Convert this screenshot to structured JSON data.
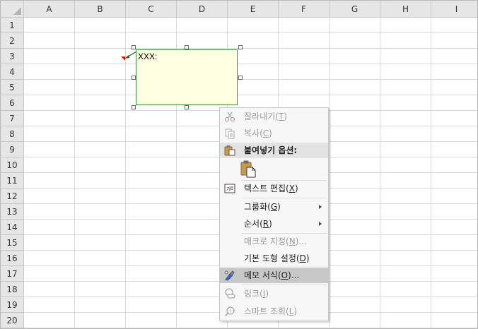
{
  "columns": [
    "A",
    "B",
    "C",
    "D",
    "E",
    "F",
    "G",
    "H",
    "I"
  ],
  "rows": [
    "1",
    "2",
    "3",
    "4",
    "5",
    "6",
    "7",
    "8",
    "9",
    "10",
    "11",
    "12",
    "13",
    "14",
    "15",
    "16",
    "17",
    "18",
    "19",
    "20"
  ],
  "comment": {
    "text": "XXX:"
  },
  "context_menu": {
    "cut": {
      "label": "잘라내기",
      "key": "T",
      "state": "disabled"
    },
    "copy": {
      "label": "복사",
      "key": "C",
      "state": "disabled"
    },
    "paste_options": {
      "label": "붙여넣기 옵션:"
    },
    "edit_text": {
      "label": "텍스트 편집",
      "key": "X"
    },
    "grouping": {
      "label": "그룹화",
      "key": "G"
    },
    "order": {
      "label": "순서",
      "key": "R"
    },
    "assign_macro": {
      "label": "매크로 지정",
      "key": "N",
      "suffix": "...",
      "state": "disabled"
    },
    "default_shape": {
      "label": "기본 도형 설정",
      "key": "D"
    },
    "format_comment": {
      "label": "메모 서식",
      "key": "O",
      "suffix": "..."
    },
    "link": {
      "label": "링크",
      "key": "I",
      "state": "disabled"
    },
    "smart_lookup": {
      "label": "스마트 조회",
      "key": "L",
      "state": "disabled"
    }
  },
  "colors": {
    "comment_bg": "#ffffe1",
    "comment_border": "#3f8a3f",
    "indicator": "#d21e1e",
    "hover": "#c8c8c8"
  }
}
